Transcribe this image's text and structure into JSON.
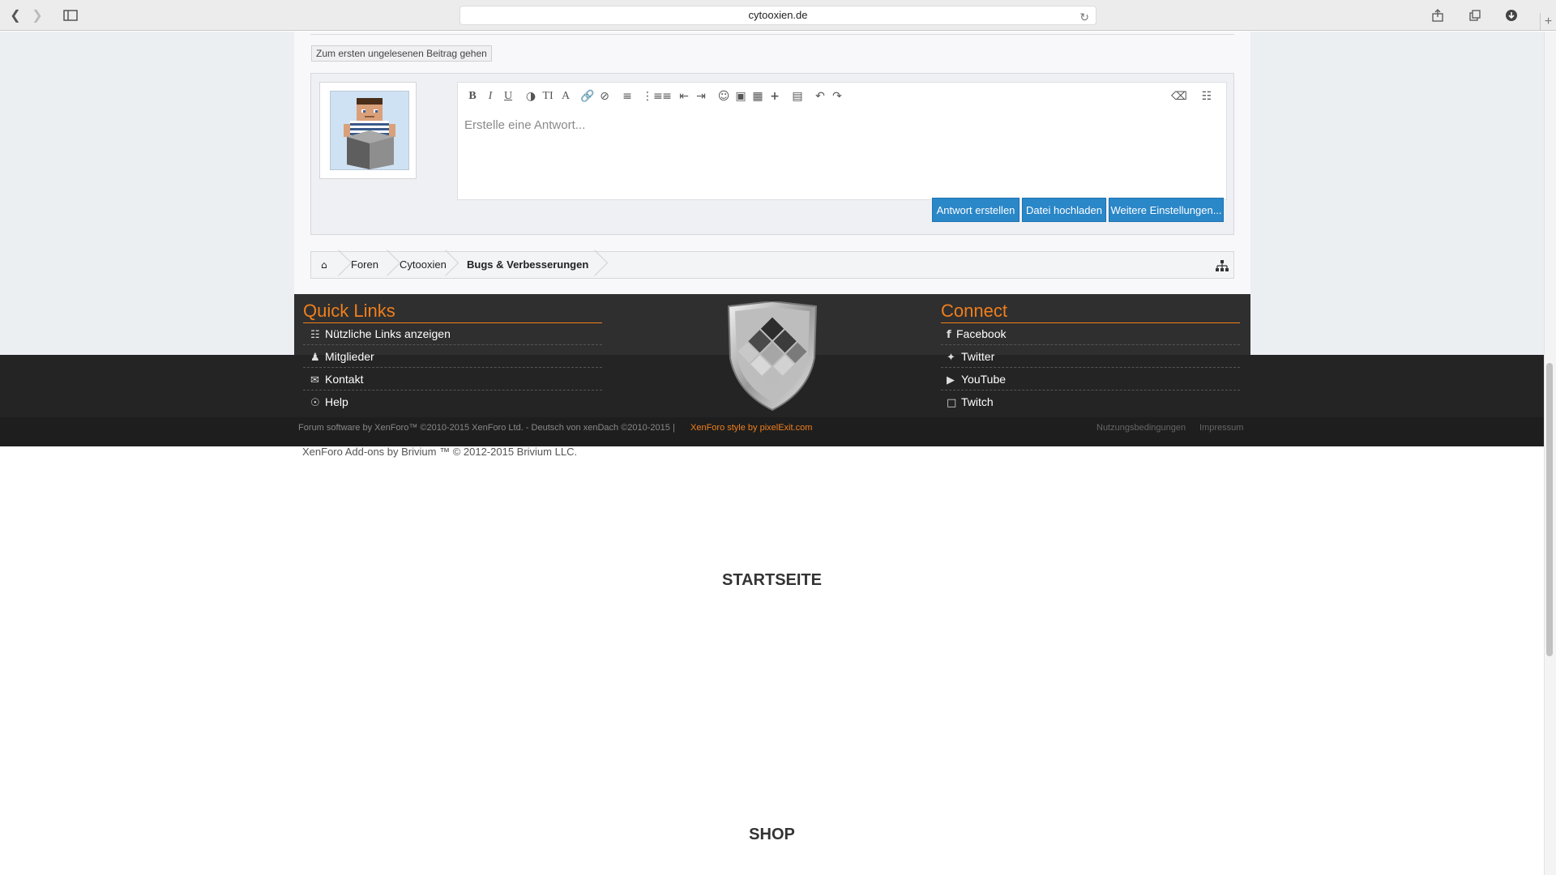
{
  "browser": {
    "url": "cytooxien.de",
    "back_icon": "chevron-left-icon",
    "forward_icon": "chevron-right-icon",
    "sidebar_icon": "sidebar-icon",
    "reload_icon": "reload-icon",
    "share_icon": "share-icon",
    "tabs_icon": "tabs-icon",
    "download_icon": "download-icon",
    "newtab_icon": "plus-icon"
  },
  "thread": {
    "unread_button": "Zum ersten ungelesenen Beitrag gehen"
  },
  "reply": {
    "placeholder": "Erstelle eine Antwort...",
    "buttons": {
      "submit": "Antwort erstellen",
      "upload": "Datei hochladen",
      "more": "Weitere Einstellungen..."
    }
  },
  "breadcrumb": {
    "home_icon": "home-icon",
    "items": [
      "Foren",
      "Cytooxien",
      "Bugs & Verbesserungen"
    ],
    "sitemap_icon": "sitemap-icon"
  },
  "footer": {
    "quick_links": {
      "title": "Quick Links",
      "items": [
        "Nützliche Links anzeigen",
        "Mitglieder",
        "Kontakt",
        "Help"
      ]
    },
    "connect": {
      "title": "Connect",
      "items": [
        "Facebook",
        "Twitter",
        "YouTube",
        "Twitch"
      ]
    },
    "copyright": "Forum software by XenForo™ ©2010-2015 XenForo Ltd. - Deutsch von xenDach ©2010-2015 |",
    "style_credit": "XenForo style by pixelExit.com",
    "terms": "Nutzungsbedingungen",
    "imprint": "Impressum",
    "addons": "XenForo Add-ons by Brivium ™ © 2012-2015 Brivium LLC."
  },
  "sections": {
    "startseite": "STARTSEITE",
    "shop": "SHOP"
  },
  "colors": {
    "accent_orange": "#f07f1c",
    "button_blue": "#2a87c8",
    "footer_dark": "#242424"
  }
}
